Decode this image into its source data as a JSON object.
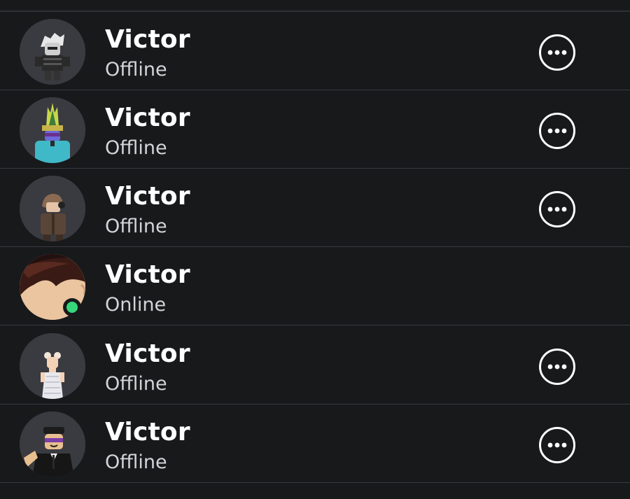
{
  "friends": [
    {
      "name": "Victor",
      "status": "Offline",
      "avatar": "avatar-white-hair-black-outfit",
      "online": false,
      "has_menu": true
    },
    {
      "name": "Victor",
      "status": "Offline",
      "avatar": "avatar-green-crown-purple-glasses",
      "online": false,
      "has_menu": true
    },
    {
      "name": "Victor",
      "status": "Offline",
      "avatar": "avatar-brown-hair-headphones",
      "online": false,
      "has_menu": true
    },
    {
      "name": "Victor",
      "status": "Online",
      "avatar": "avatar-classic-face-closeup",
      "online": true,
      "has_menu": false
    },
    {
      "name": "Victor",
      "status": "Offline",
      "avatar": "avatar-white-dress",
      "online": false,
      "has_menu": true
    },
    {
      "name": "Victor",
      "status": "Offline",
      "avatar": "avatar-suit-cap-sunglasses",
      "online": false,
      "has_menu": true
    }
  ],
  "icons": {
    "more": "more-options-icon",
    "presence": "online-indicator"
  },
  "colors": {
    "background": "#18191b",
    "divider": "#393a3e",
    "online": "#36d67a",
    "status_text": "#d3d4d7"
  }
}
